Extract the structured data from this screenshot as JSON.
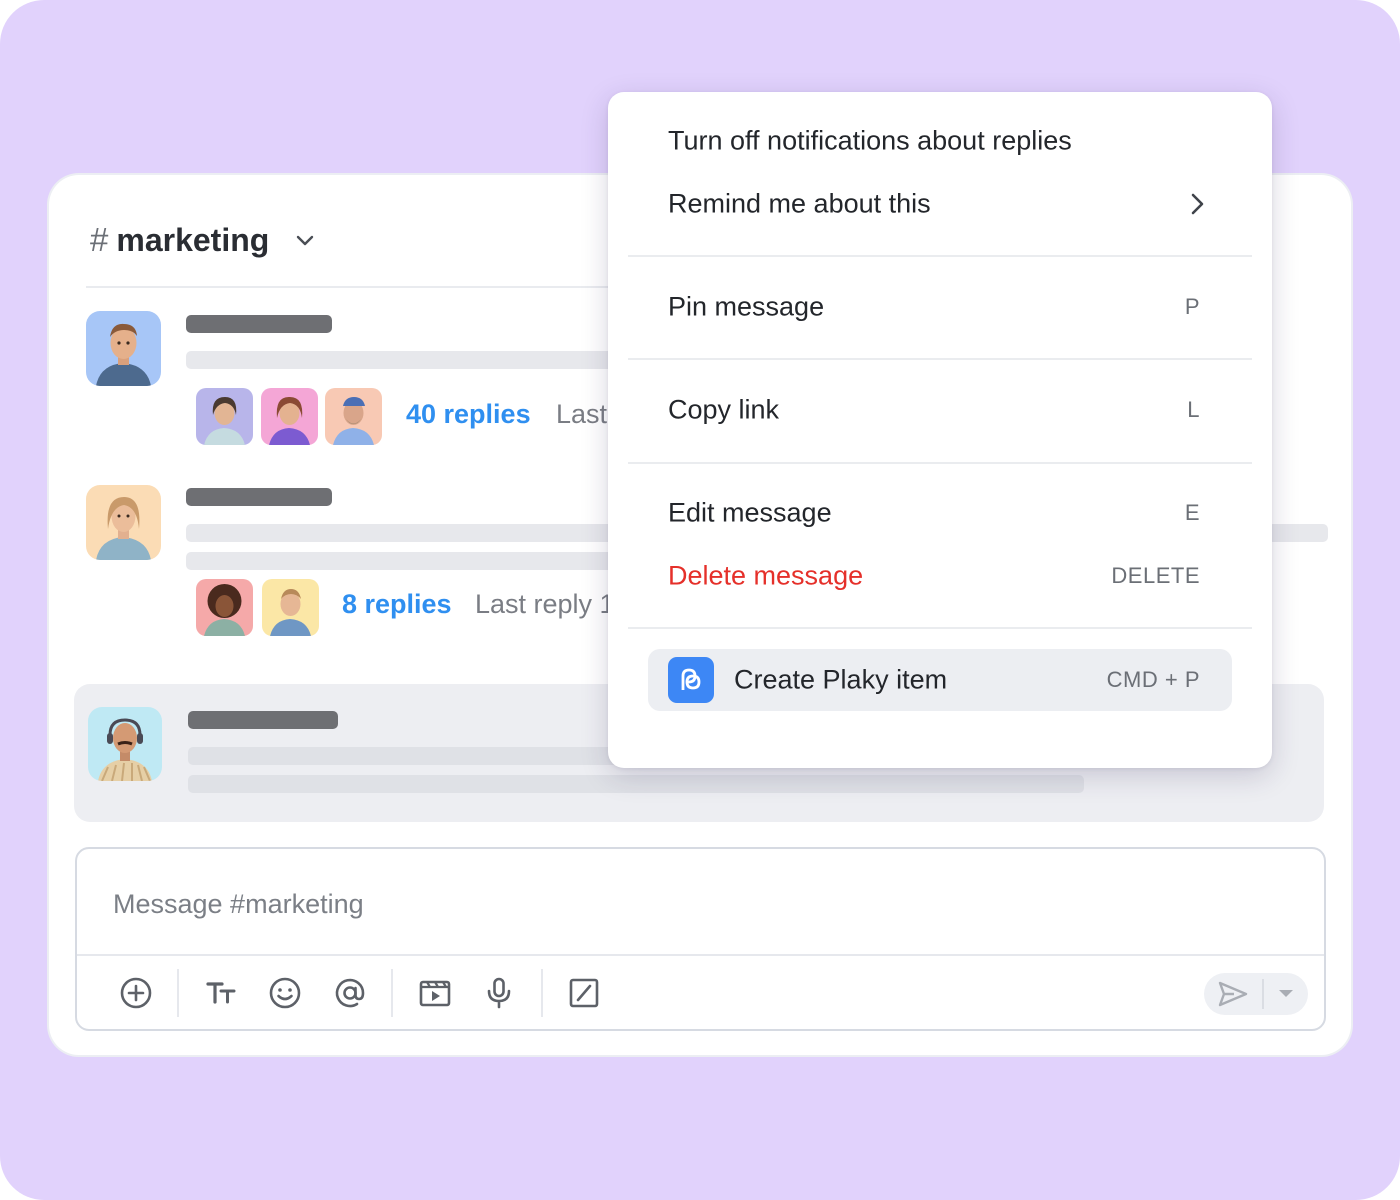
{
  "channel": {
    "hash": "#",
    "name": "marketing"
  },
  "threads": [
    {
      "replies_label": "40 replies",
      "last_reply_label": "Last",
      "repliers": [
        "replier-avatar",
        "replier-avatar",
        "replier-avatar"
      ]
    },
    {
      "replies_label": "8 replies",
      "last_reply_label": "Last reply 1",
      "repliers": [
        "replier-avatar",
        "replier-avatar"
      ]
    }
  ],
  "composer": {
    "placeholder": "Message #marketing",
    "tools": [
      "add-icon",
      "text-format-icon",
      "emoji-icon",
      "mention-icon",
      "video-clip-icon",
      "microphone-icon",
      "slash-command-icon",
      "send-icon",
      "caret-down-icon"
    ]
  },
  "context_menu": {
    "turn_off_notifications": "Turn off notifications about replies",
    "remind_me": "Remind me about this",
    "pin_message": "Pin message",
    "pin_shortcut": "P",
    "copy_link": "Copy link",
    "copy_shortcut": "L",
    "edit_message": "Edit message",
    "edit_shortcut": "E",
    "delete_message": "Delete message",
    "delete_shortcut": "DELETE",
    "create_plaky_item": "Create Plaky item",
    "plaky_shortcut": "CMD + P"
  },
  "colors": {
    "background": "#e1d2fc",
    "link": "#2f8ff0",
    "danger": "#e5302a",
    "plaky_brand": "#3d87f5"
  }
}
